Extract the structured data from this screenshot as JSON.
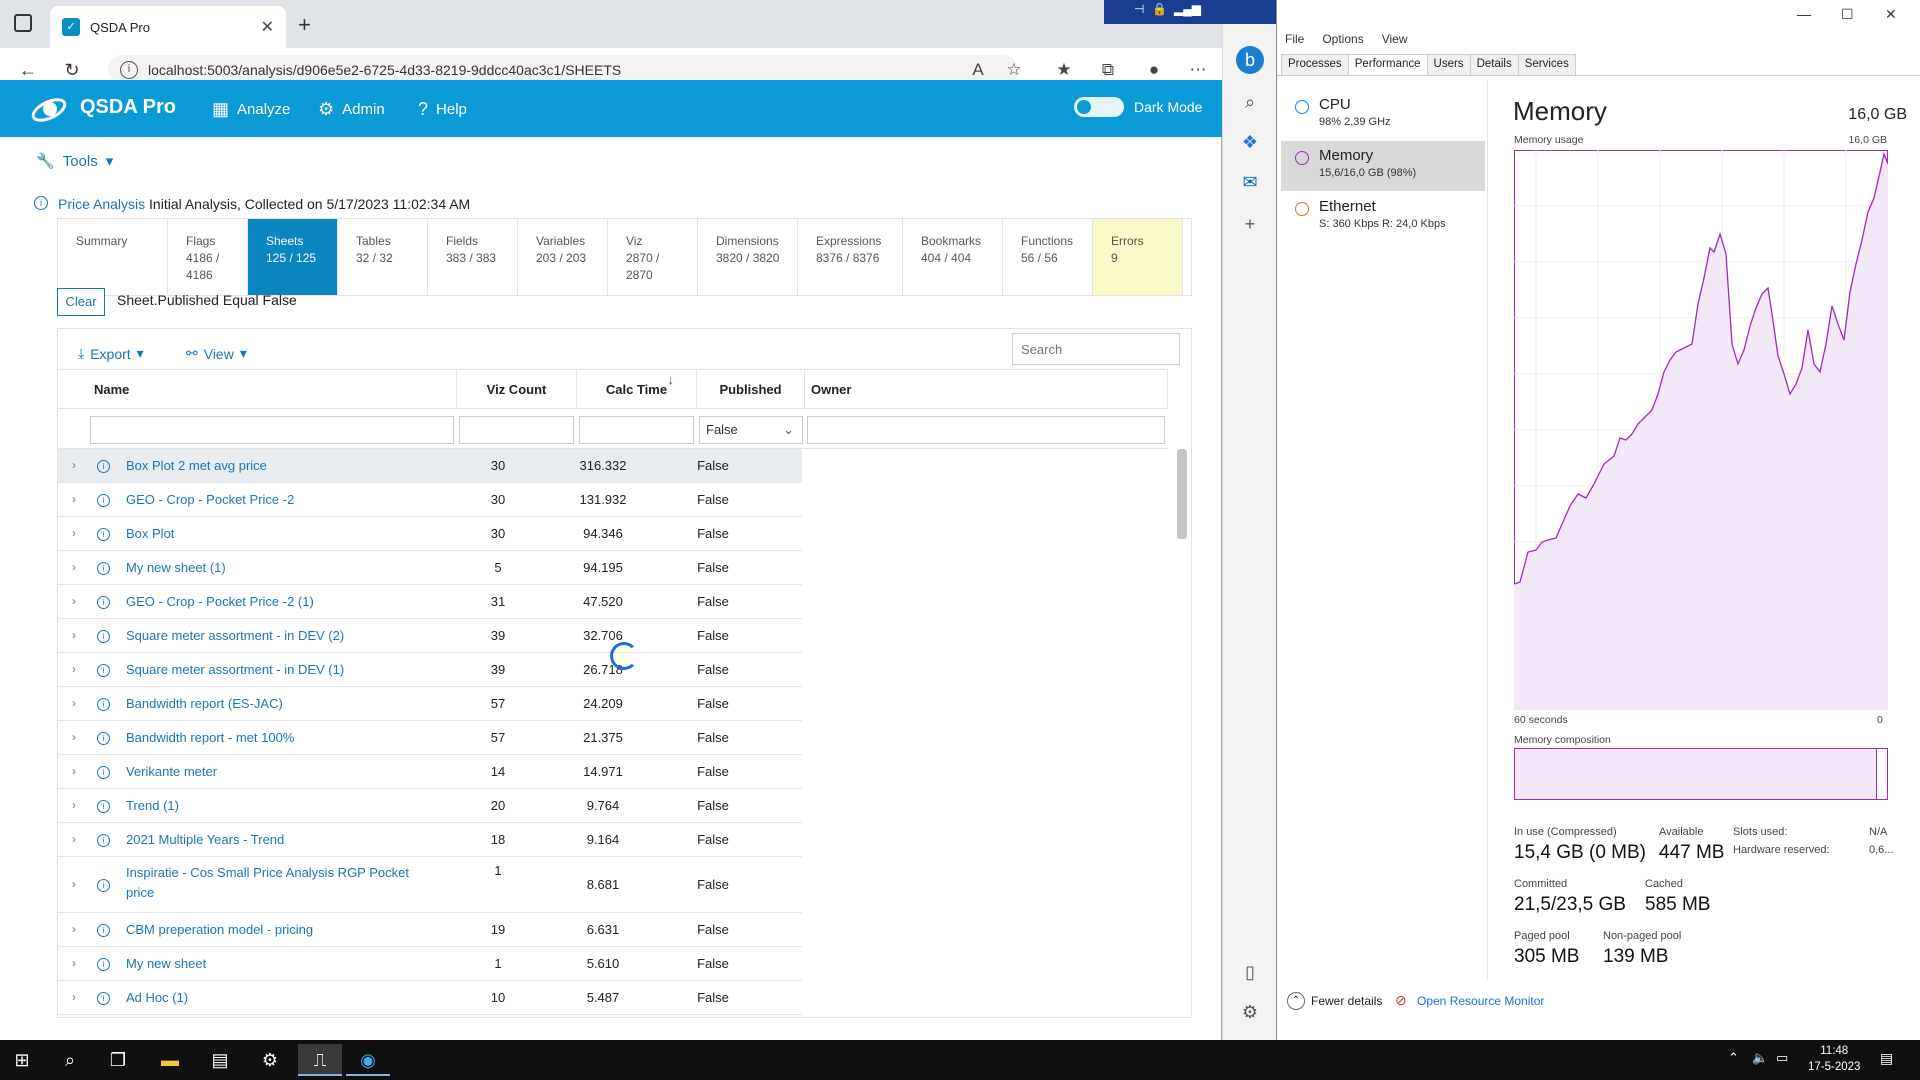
{
  "browser": {
    "tab_title": "QSDA Pro",
    "url": "localhost:5003/analysis/d906e5e2-6725-4d33-8219-9ddcc40ac3c1/SHEETS"
  },
  "app": {
    "brand": "QSDA Pro",
    "nav": {
      "analyze": "Analyze",
      "admin": "Admin",
      "help": "Help"
    },
    "dark_mode_label": "Dark Mode",
    "tools_label": "Tools",
    "info": {
      "link": "Price Analysis",
      "text": " Initial Analysis, Collected on 5/17/2023 11:02:34 AM"
    },
    "stat_tabs": [
      {
        "label": "Summary",
        "value": ""
      },
      {
        "label": "Flags",
        "value": "4186 / 4186"
      },
      {
        "label": "Sheets",
        "value": "125 / 125"
      },
      {
        "label": "Tables",
        "value": "32 / 32"
      },
      {
        "label": "Fields",
        "value": "383 / 383"
      },
      {
        "label": "Variables",
        "value": "203 / 203"
      },
      {
        "label": "Viz",
        "value": "2870 / 2870"
      },
      {
        "label": "Dimensions",
        "value": "3820 / 3820"
      },
      {
        "label": "Expressions",
        "value": "8376 / 8376"
      },
      {
        "label": "Bookmarks",
        "value": "404 / 404"
      },
      {
        "label": "Functions",
        "value": "56 / 56"
      },
      {
        "label": "Errors",
        "value": "9"
      }
    ],
    "filter": {
      "clear": "Clear",
      "text": "Sheet.Published Equal False"
    },
    "grid": {
      "export": "Export",
      "view": "View",
      "search_placeholder": "Search",
      "columns": {
        "name": "Name",
        "viz_count": "Viz Count",
        "calc_time": "Calc Time",
        "published": "Published",
        "owner": "Owner"
      },
      "published_filter": "False",
      "rows": [
        {
          "name": "Box Plot 2 met avg price",
          "viz": "30",
          "calc": "316.332",
          "pub": "False"
        },
        {
          "name": "GEO - Crop - Pocket Price -2",
          "viz": "30",
          "calc": "131.932",
          "pub": "False"
        },
        {
          "name": "Box Plot",
          "viz": "30",
          "calc": "94.346",
          "pub": "False"
        },
        {
          "name": "My new sheet (1)",
          "viz": "5",
          "calc": "94.195",
          "pub": "False"
        },
        {
          "name": "GEO - Crop - Pocket Price -2 (1)",
          "viz": "31",
          "calc": "47.520",
          "pub": "False"
        },
        {
          "name": "Square meter assortment - in DEV (2)",
          "viz": "39",
          "calc": "32.706",
          "pub": "False"
        },
        {
          "name": "Square meter assortment - in DEV (1)",
          "viz": "39",
          "calc": "26.718",
          "pub": "False"
        },
        {
          "name": "Bandwidth report (ES-JAC)",
          "viz": "57",
          "calc": "24.209",
          "pub": "False"
        },
        {
          "name": "Bandwidth report - met 100%",
          "viz": "57",
          "calc": "21.375",
          "pub": "False"
        },
        {
          "name": "Verikante meter",
          "viz": "14",
          "calc": "14.971",
          "pub": "False"
        },
        {
          "name": "Trend (1)",
          "viz": "20",
          "calc": "9.764",
          "pub": "False"
        },
        {
          "name": "2021 Multiple Years - Trend",
          "viz": "18",
          "calc": "9.164",
          "pub": "False"
        },
        {
          "name": "Inspiratie - Cos Small Price Analysis RGP Pocket price",
          "viz": "1",
          "calc": "8.681",
          "pub": "False"
        },
        {
          "name": "CBM preperation model - pricing",
          "viz": "19",
          "calc": "6.631",
          "pub": "False"
        },
        {
          "name": "My new sheet",
          "viz": "1",
          "calc": "5.610",
          "pub": "False"
        },
        {
          "name": "Ad Hoc (1)",
          "viz": "10",
          "calc": "5.487",
          "pub": "False"
        }
      ]
    }
  },
  "taskmgr": {
    "menu": [
      "File",
      "Options",
      "View"
    ],
    "tabs": [
      "Processes",
      "Performance",
      "Users",
      "Details",
      "Services"
    ],
    "resources": [
      {
        "name": "CPU",
        "sub": "98% 2,39 GHz",
        "color": "#1a7fd0"
      },
      {
        "name": "Memory",
        "sub": "15,6/16,0 GB (98%)",
        "color": "#9d2bbd"
      },
      {
        "name": "Ethernet",
        "sub": "S: 360 Kbps R: 24,0 Kbps",
        "color": "#c8782b"
      }
    ],
    "memory_title": "Memory",
    "memory_total": "16,0 GB",
    "usage_label": "Memory usage",
    "usage_max": "16,0 GB",
    "time_label": "60 seconds",
    "time_zero": "0",
    "composition_label": "Memory composition",
    "stats": {
      "in_use_label": "In use (Compressed)",
      "in_use": "15,4 GB (0 MB)",
      "available_label": "Available",
      "available": "447 MB",
      "slots_label": "Slots used:",
      "slots": "N/A",
      "hw_label": "Hardware reserved:",
      "hw": "0,6...",
      "committed_label": "Committed",
      "committed": "21,5/23,5 GB",
      "cached_label": "Cached",
      "cached": "585 MB",
      "paged_label": "Paged pool",
      "paged": "305 MB",
      "nonpaged_label": "Non-paged pool",
      "nonpaged": "139 MB"
    },
    "fewer_details": "Fewer details",
    "resource_monitor": "Open Resource Monitor"
  },
  "taskbar": {
    "time": "11:48",
    "date": "17-5-2023"
  }
}
